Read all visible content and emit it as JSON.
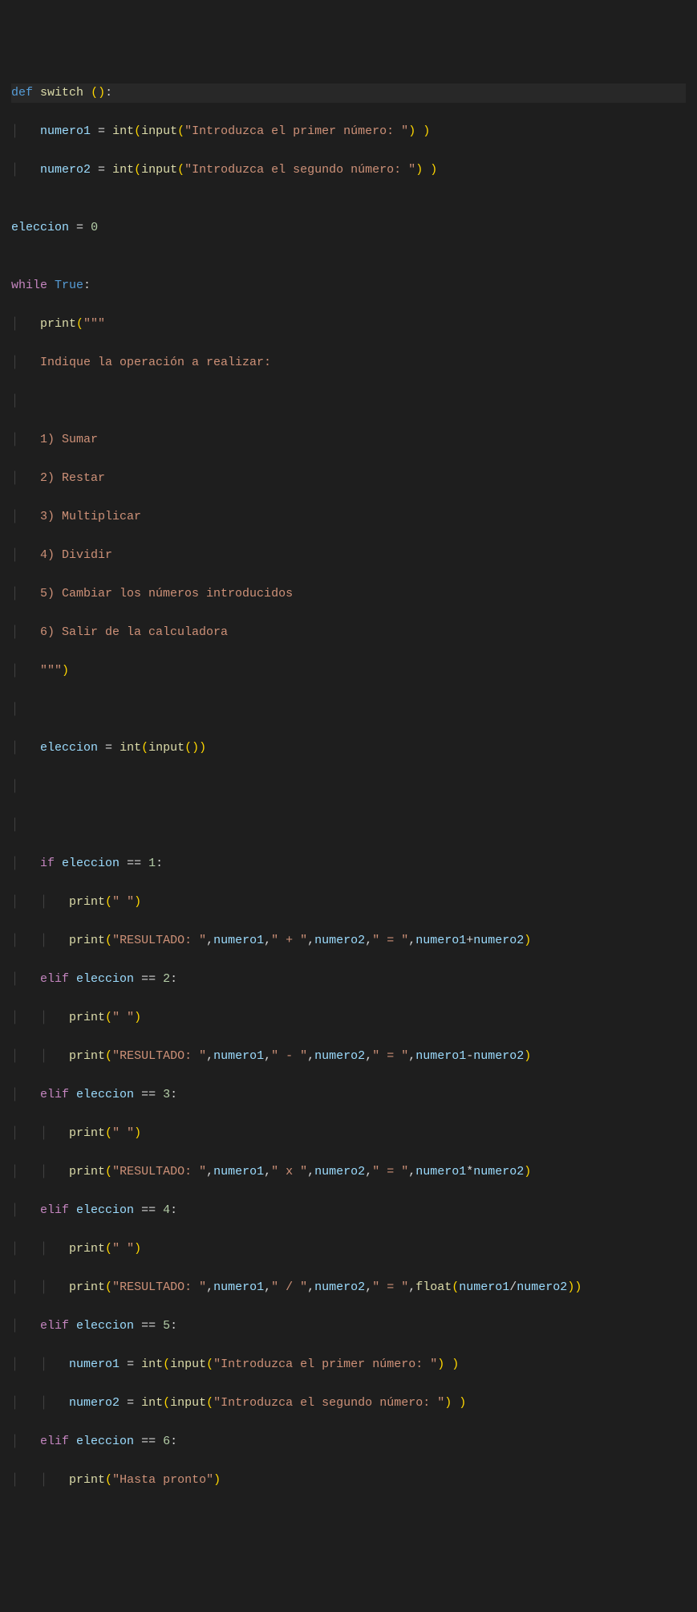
{
  "code": {
    "lines": [
      {
        "indent": 0,
        "hl": true,
        "tokens": [
          [
            "kw",
            "def"
          ],
          [
            "sp",
            " "
          ],
          [
            "fn",
            "switch"
          ],
          [
            "sp",
            " "
          ],
          [
            "paren",
            "("
          ],
          [
            "paren",
            ")"
          ],
          [
            "op",
            ":"
          ]
        ]
      },
      {
        "indent": 1,
        "tokens": [
          [
            "var",
            "numero1"
          ],
          [
            "sp",
            " "
          ],
          [
            "op",
            "="
          ],
          [
            "sp",
            " "
          ],
          [
            "fn",
            "int"
          ],
          [
            "paren",
            "("
          ],
          [
            "fn",
            "input"
          ],
          [
            "paren",
            "("
          ],
          [
            "str",
            "\"Introduzca el primer número: \""
          ],
          [
            "paren",
            ")"
          ],
          [
            "sp",
            " "
          ],
          [
            "paren",
            ")"
          ]
        ]
      },
      {
        "indent": 1,
        "tokens": [
          [
            "var",
            "numero2"
          ],
          [
            "sp",
            " "
          ],
          [
            "op",
            "="
          ],
          [
            "sp",
            " "
          ],
          [
            "fn",
            "int"
          ],
          [
            "paren",
            "("
          ],
          [
            "fn",
            "input"
          ],
          [
            "paren",
            "("
          ],
          [
            "str",
            "\"Introduzca el segundo número: \""
          ],
          [
            "paren",
            ")"
          ],
          [
            "sp",
            " "
          ],
          [
            "paren",
            ")"
          ]
        ]
      },
      {
        "indent": 0,
        "blank": true
      },
      {
        "indent": 0,
        "tokens": [
          [
            "var",
            "eleccion"
          ],
          [
            "sp",
            " "
          ],
          [
            "op",
            "="
          ],
          [
            "sp",
            " "
          ],
          [
            "num",
            "0"
          ]
        ]
      },
      {
        "indent": 0,
        "blank": true
      },
      {
        "indent": 0,
        "tokens": [
          [
            "kw-flow",
            "while"
          ],
          [
            "sp",
            " "
          ],
          [
            "const",
            "True"
          ],
          [
            "op",
            ":"
          ]
        ]
      },
      {
        "indent": 1,
        "tokens": [
          [
            "fn",
            "print"
          ],
          [
            "paren",
            "("
          ],
          [
            "str",
            "\"\"\""
          ]
        ]
      },
      {
        "indent": 1,
        "tokens": [
          [
            "str",
            "Indique la operación a realizar:"
          ]
        ]
      },
      {
        "indent": 1,
        "blank": true,
        "string": true
      },
      {
        "indent": 1,
        "tokens": [
          [
            "str",
            "1) Sumar"
          ]
        ]
      },
      {
        "indent": 1,
        "tokens": [
          [
            "str",
            "2) Restar"
          ]
        ]
      },
      {
        "indent": 1,
        "tokens": [
          [
            "str",
            "3) Multiplicar"
          ]
        ]
      },
      {
        "indent": 1,
        "tokens": [
          [
            "str",
            "4) Dividir"
          ]
        ]
      },
      {
        "indent": 1,
        "tokens": [
          [
            "str",
            "5) Cambiar los números introducidos"
          ]
        ]
      },
      {
        "indent": 1,
        "tokens": [
          [
            "str",
            "6) Salir de la calculadora"
          ]
        ]
      },
      {
        "indent": 1,
        "tokens": [
          [
            "str",
            "\"\"\""
          ],
          [
            "paren",
            ")"
          ]
        ]
      },
      {
        "indent": 1,
        "blank": true
      },
      {
        "indent": 1,
        "tokens": [
          [
            "var",
            "eleccion"
          ],
          [
            "sp",
            " "
          ],
          [
            "op",
            "="
          ],
          [
            "sp",
            " "
          ],
          [
            "fn",
            "int"
          ],
          [
            "paren",
            "("
          ],
          [
            "fn",
            "input"
          ],
          [
            "paren",
            "("
          ],
          [
            "paren",
            ")"
          ],
          [
            "paren",
            ")"
          ]
        ]
      },
      {
        "indent": 1,
        "blank": true
      },
      {
        "indent": 1,
        "blank": true
      },
      {
        "indent": 1,
        "tokens": [
          [
            "kw-flow",
            "if"
          ],
          [
            "sp",
            " "
          ],
          [
            "var",
            "eleccion"
          ],
          [
            "sp",
            " "
          ],
          [
            "op",
            "=="
          ],
          [
            "sp",
            " "
          ],
          [
            "num",
            "1"
          ],
          [
            "op",
            ":"
          ]
        ]
      },
      {
        "indent": 2,
        "tokens": [
          [
            "fn",
            "print"
          ],
          [
            "paren",
            "("
          ],
          [
            "str",
            "\" \""
          ],
          [
            "paren",
            ")"
          ]
        ]
      },
      {
        "indent": 2,
        "tokens": [
          [
            "fn",
            "print"
          ],
          [
            "paren",
            "("
          ],
          [
            "str",
            "\"RESULTADO: \""
          ],
          [
            "op",
            ","
          ],
          [
            "var",
            "numero1"
          ],
          [
            "op",
            ","
          ],
          [
            "str",
            "\" + \""
          ],
          [
            "op",
            ","
          ],
          [
            "var",
            "numero2"
          ],
          [
            "op",
            ","
          ],
          [
            "str",
            "\" = \""
          ],
          [
            "op",
            ","
          ],
          [
            "var",
            "numero1"
          ],
          [
            "op",
            "+"
          ],
          [
            "var",
            "numero2"
          ],
          [
            "paren",
            ")"
          ]
        ]
      },
      {
        "indent": 1,
        "tokens": [
          [
            "kw-flow",
            "elif"
          ],
          [
            "sp",
            " "
          ],
          [
            "var",
            "eleccion"
          ],
          [
            "sp",
            " "
          ],
          [
            "op",
            "=="
          ],
          [
            "sp",
            " "
          ],
          [
            "num",
            "2"
          ],
          [
            "op",
            ":"
          ]
        ]
      },
      {
        "indent": 2,
        "tokens": [
          [
            "fn",
            "print"
          ],
          [
            "paren",
            "("
          ],
          [
            "str",
            "\" \""
          ],
          [
            "paren",
            ")"
          ]
        ]
      },
      {
        "indent": 2,
        "tokens": [
          [
            "fn",
            "print"
          ],
          [
            "paren",
            "("
          ],
          [
            "str",
            "\"RESULTADO: \""
          ],
          [
            "op",
            ","
          ],
          [
            "var",
            "numero1"
          ],
          [
            "op",
            ","
          ],
          [
            "str",
            "\" - \""
          ],
          [
            "op",
            ","
          ],
          [
            "var",
            "numero2"
          ],
          [
            "op",
            ","
          ],
          [
            "str",
            "\" = \""
          ],
          [
            "op",
            ","
          ],
          [
            "var",
            "numero1"
          ],
          [
            "op",
            "-"
          ],
          [
            "var",
            "numero2"
          ],
          [
            "paren",
            ")"
          ]
        ]
      },
      {
        "indent": 1,
        "tokens": [
          [
            "kw-flow",
            "elif"
          ],
          [
            "sp",
            " "
          ],
          [
            "var",
            "eleccion"
          ],
          [
            "sp",
            " "
          ],
          [
            "op",
            "=="
          ],
          [
            "sp",
            " "
          ],
          [
            "num",
            "3"
          ],
          [
            "op",
            ":"
          ]
        ]
      },
      {
        "indent": 2,
        "tokens": [
          [
            "fn",
            "print"
          ],
          [
            "paren",
            "("
          ],
          [
            "str",
            "\" \""
          ],
          [
            "paren",
            ")"
          ]
        ]
      },
      {
        "indent": 2,
        "tokens": [
          [
            "fn",
            "print"
          ],
          [
            "paren",
            "("
          ],
          [
            "str",
            "\"RESULTADO: \""
          ],
          [
            "op",
            ","
          ],
          [
            "var",
            "numero1"
          ],
          [
            "op",
            ","
          ],
          [
            "str",
            "\" x \""
          ],
          [
            "op",
            ","
          ],
          [
            "var",
            "numero2"
          ],
          [
            "op",
            ","
          ],
          [
            "str",
            "\" = \""
          ],
          [
            "op",
            ","
          ],
          [
            "var",
            "numero1"
          ],
          [
            "op",
            "*"
          ],
          [
            "var",
            "numero2"
          ],
          [
            "paren",
            ")"
          ]
        ]
      },
      {
        "indent": 1,
        "tokens": [
          [
            "kw-flow",
            "elif"
          ],
          [
            "sp",
            " "
          ],
          [
            "var",
            "eleccion"
          ],
          [
            "sp",
            " "
          ],
          [
            "op",
            "=="
          ],
          [
            "sp",
            " "
          ],
          [
            "num",
            "4"
          ],
          [
            "op",
            ":"
          ]
        ]
      },
      {
        "indent": 2,
        "tokens": [
          [
            "fn",
            "print"
          ],
          [
            "paren",
            "("
          ],
          [
            "str",
            "\" \""
          ],
          [
            "paren",
            ")"
          ]
        ]
      },
      {
        "indent": 2,
        "tokens": [
          [
            "fn",
            "print"
          ],
          [
            "paren",
            "("
          ],
          [
            "str",
            "\"RESULTADO: \""
          ],
          [
            "op",
            ","
          ],
          [
            "var",
            "numero1"
          ],
          [
            "op",
            ","
          ],
          [
            "str",
            "\" / \""
          ],
          [
            "op",
            ","
          ],
          [
            "var",
            "numero2"
          ],
          [
            "op",
            ","
          ],
          [
            "str",
            "\" = \""
          ],
          [
            "op",
            ","
          ],
          [
            "fn",
            "float"
          ],
          [
            "paren",
            "("
          ],
          [
            "var",
            "numero1"
          ],
          [
            "op",
            "/"
          ],
          [
            "var",
            "numero2"
          ],
          [
            "paren",
            ")"
          ],
          [
            "paren",
            ")"
          ]
        ]
      },
      {
        "indent": 1,
        "tokens": [
          [
            "kw-flow",
            "elif"
          ],
          [
            "sp",
            " "
          ],
          [
            "var",
            "eleccion"
          ],
          [
            "sp",
            " "
          ],
          [
            "op",
            "=="
          ],
          [
            "sp",
            " "
          ],
          [
            "num",
            "5"
          ],
          [
            "op",
            ":"
          ]
        ]
      },
      {
        "indent": 2,
        "tokens": [
          [
            "var",
            "numero1"
          ],
          [
            "sp",
            " "
          ],
          [
            "op",
            "="
          ],
          [
            "sp",
            " "
          ],
          [
            "fn",
            "int"
          ],
          [
            "paren",
            "("
          ],
          [
            "fn",
            "input"
          ],
          [
            "paren",
            "("
          ],
          [
            "str",
            "\"Introduzca el primer número: \""
          ],
          [
            "paren",
            ")"
          ],
          [
            "sp",
            " "
          ],
          [
            "paren",
            ")"
          ]
        ]
      },
      {
        "indent": 2,
        "tokens": [
          [
            "var",
            "numero2"
          ],
          [
            "sp",
            " "
          ],
          [
            "op",
            "="
          ],
          [
            "sp",
            " "
          ],
          [
            "fn",
            "int"
          ],
          [
            "paren",
            "("
          ],
          [
            "fn",
            "input"
          ],
          [
            "paren",
            "("
          ],
          [
            "str",
            "\"Introduzca el segundo número: \""
          ],
          [
            "paren",
            ")"
          ],
          [
            "sp",
            " "
          ],
          [
            "paren",
            ")"
          ]
        ]
      },
      {
        "indent": 1,
        "tokens": [
          [
            "kw-flow",
            "elif"
          ],
          [
            "sp",
            " "
          ],
          [
            "var",
            "eleccion"
          ],
          [
            "sp",
            " "
          ],
          [
            "op",
            "=="
          ],
          [
            "sp",
            " "
          ],
          [
            "num",
            "6"
          ],
          [
            "op",
            ":"
          ]
        ]
      },
      {
        "indent": 2,
        "tokens": [
          [
            "fn",
            "print"
          ],
          [
            "paren",
            "("
          ],
          [
            "str",
            "\"Hasta pronto\""
          ],
          [
            "paren",
            ")"
          ]
        ]
      }
    ]
  }
}
